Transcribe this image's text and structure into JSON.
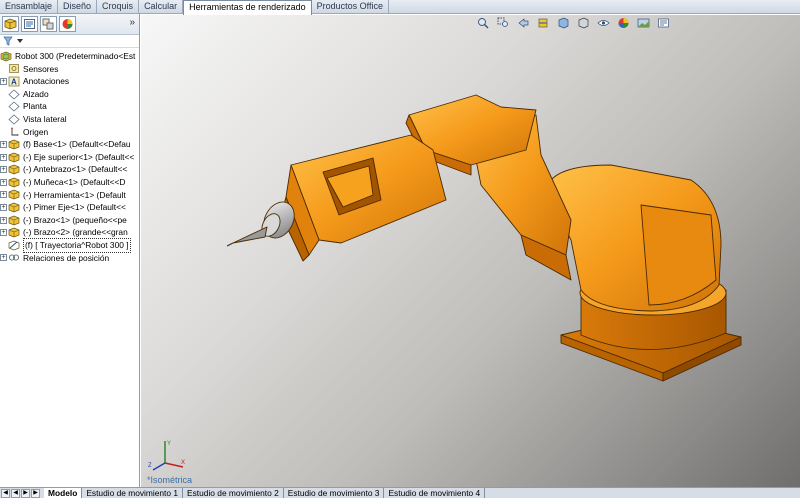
{
  "command_tabs": [
    "Ensamblaje",
    "Diseño",
    "Croquis",
    "Calcular",
    "Herramientas de renderizado",
    "Productos Office"
  ],
  "active_command_tab": 4,
  "tree": [
    {
      "label": "Robot 300  (Predeterminado<Est",
      "icon": "assembly-icon",
      "expander": ""
    },
    {
      "label": "Sensores",
      "icon": "sensors-icon",
      "expander": ""
    },
    {
      "label": "Anotaciones",
      "icon": "annotations-icon",
      "expander": "+"
    },
    {
      "label": "Alzado",
      "icon": "plane-icon",
      "expander": ""
    },
    {
      "label": "Planta",
      "icon": "plane-icon",
      "expander": ""
    },
    {
      "label": "Vista lateral",
      "icon": "plane-icon",
      "expander": ""
    },
    {
      "label": "Origen",
      "icon": "origin-icon",
      "expander": ""
    },
    {
      "label": "(f) Base<1> (Default<<Defau",
      "icon": "part-icon",
      "expander": "+"
    },
    {
      "label": "(-) Eje superior<1> (Default<<",
      "icon": "part-icon",
      "expander": "+"
    },
    {
      "label": "(-) Antebrazo<1> (Default<<",
      "icon": "part-icon",
      "expander": "+"
    },
    {
      "label": "(-) Muñeca<1> (Default<<D",
      "icon": "part-icon",
      "expander": "+"
    },
    {
      "label": "(-) Herramienta<1> (Default",
      "icon": "part-icon",
      "expander": "+"
    },
    {
      "label": "(-) Pimer Eje<1> (Default<<",
      "icon": "part-icon",
      "expander": "+"
    },
    {
      "label": "(-) Brazo<1> (pequeño<<pe",
      "icon": "part-icon",
      "expander": "+"
    },
    {
      "label": "(-) Brazo<2> (grande<<gran",
      "icon": "part-icon",
      "expander": "+"
    },
    {
      "label": "(f) [ Trayectoria^Robot 300 ]",
      "icon": "sketch-part-icon",
      "expander": ""
    },
    {
      "label": "Relaciones de posición",
      "icon": "mates-icon",
      "expander": "+"
    }
  ],
  "viewport": {
    "view_name": "*Isométrica",
    "model_color": "#f59a1b"
  },
  "bottom_tabs": [
    "Modelo",
    "Estudio de movimiento 1",
    "Estudio de movimiento 2",
    "Estudio de movimiento 3",
    "Estudio de movimiento 4"
  ],
  "active_bottom_tab": 0,
  "hud_icons": [
    "zoom-fit-icon",
    "zoom-area-icon",
    "previous-view-icon",
    "section-view-icon",
    "view-orientation-icon",
    "display-style-icon",
    "hide-show-icon",
    "appearance-icon",
    "scene-icon",
    "view-settings-icon"
  ]
}
